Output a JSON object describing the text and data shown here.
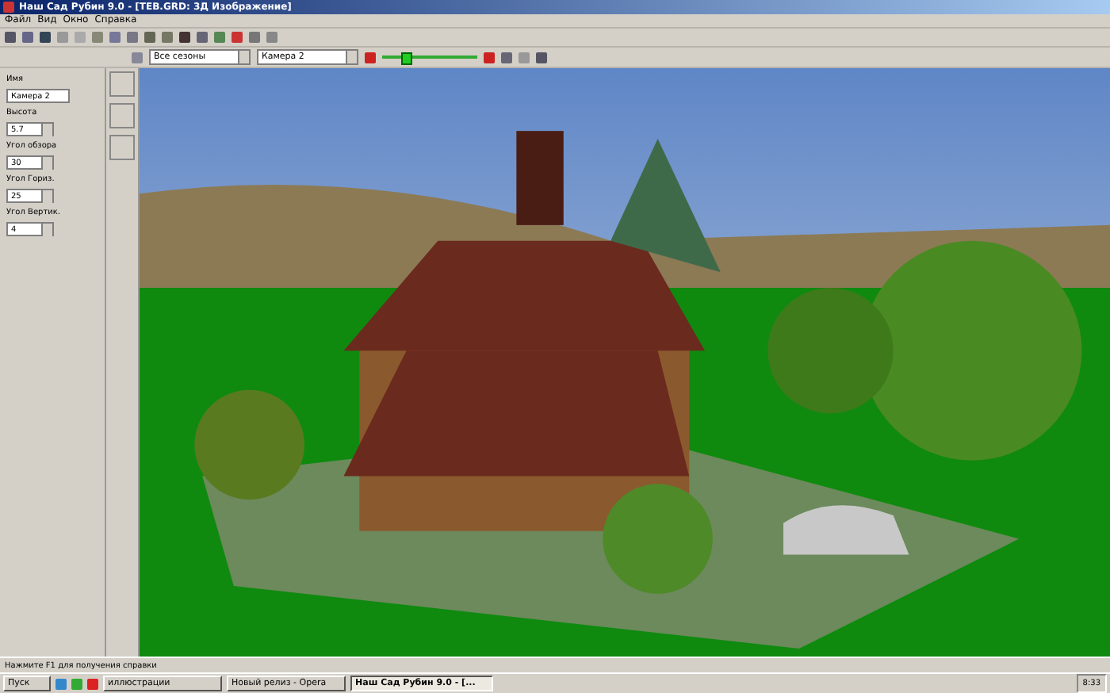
{
  "window": {
    "title": "Наш Сад Рубин 9.0 - [TEB.GRD: 3Д Изображение]"
  },
  "menu": [
    "Файл",
    "Вид",
    "Окно",
    "Справка"
  ],
  "view_toolbar": {
    "season": "Все сезоны",
    "camera": "Камера 2",
    "sun": {
      "level": 0.22
    }
  },
  "camera_panel": {
    "fields": [
      {
        "label": "Имя",
        "value": "Камера 2",
        "kind": "text"
      },
      {
        "label": "Высота",
        "value": "5.7",
        "kind": "spin"
      },
      {
        "label": "Угол обзора",
        "value": "30",
        "kind": "spin"
      },
      {
        "label": "Угол Гориз.",
        "value": "25",
        "kind": "spin"
      },
      {
        "label": "Угол Вертик.",
        "value": "4",
        "kind": "spin"
      }
    ]
  },
  "status_bar": {
    "text": "Нажмите F1 для получения справки"
  },
  "taskbar": {
    "start": "Пуск",
    "tasks": [
      {
        "label": "иллюстрации",
        "selected": false
      },
      {
        "label": "Новый релиз - Opera",
        "selected": false
      },
      {
        "label": "Наш Сад Рубин 9.0 - [...",
        "selected": true
      }
    ],
    "clock": "8:33"
  }
}
